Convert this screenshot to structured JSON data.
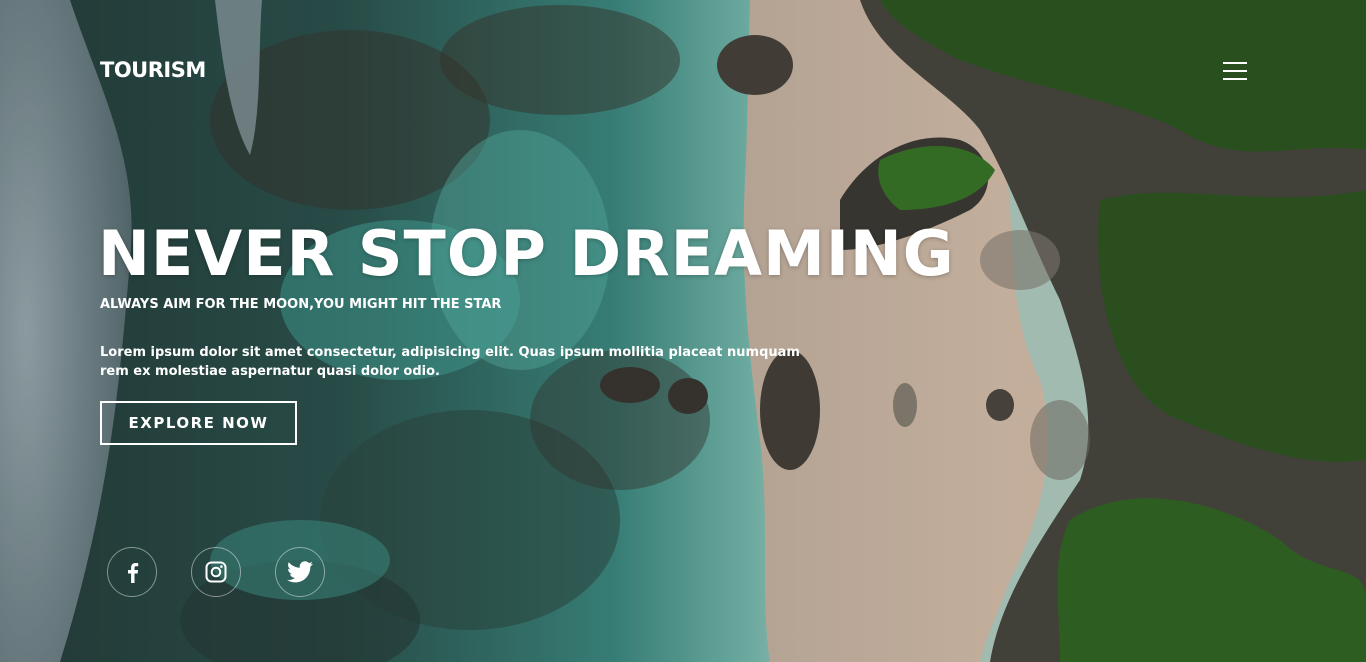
{
  "brand": {
    "logo_text": "TOURISM"
  },
  "nav": {
    "menu_icon": "hamburger-menu-icon"
  },
  "hero": {
    "title": "NEVER STOP DREAMING",
    "subtitle": "ALWAYS AIM FOR THE MOON,YOU MIGHT HIT THE STAR",
    "description": "Lorem ipsum dolor sit amet consectetur, adipisicing elit. Quas ipsum mollitia placeat numquam rem ex molestiae aspernatur quasi dolor odio.",
    "cta_label": "EXPLORE NOW"
  },
  "social": [
    {
      "icon": "facebook-icon"
    },
    {
      "icon": "instagram-icon"
    },
    {
      "icon": "twitter-icon"
    }
  ],
  "colors": {
    "text": "#ffffff",
    "ocean_deep": "#1e3a37",
    "water_turquoise": "#4fb3a6",
    "sand": "#d9c2ae",
    "vegetation": "#2f5a24"
  }
}
